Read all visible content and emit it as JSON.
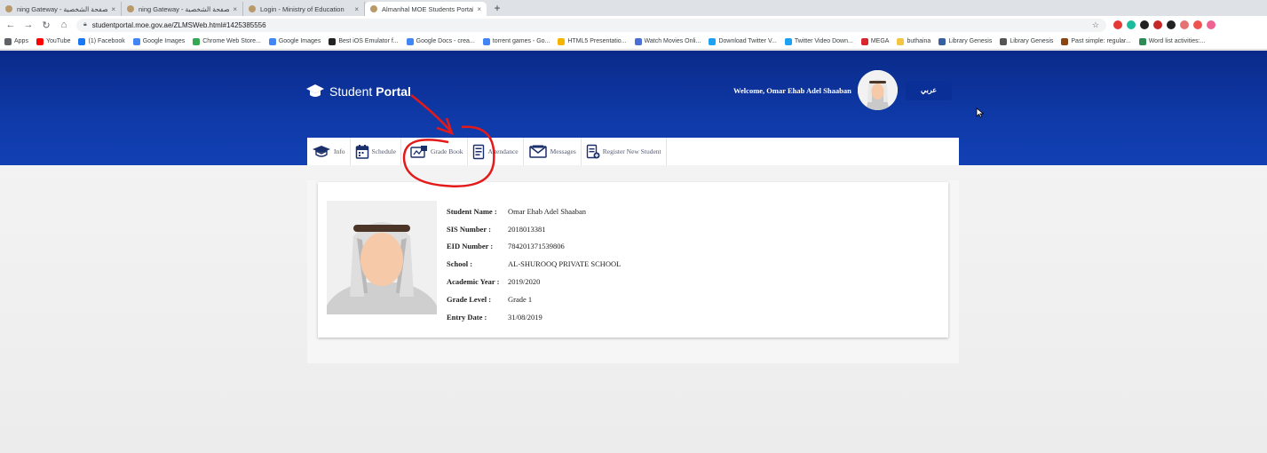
{
  "browser": {
    "tabs": [
      {
        "title": "ning Gateway - الصفحة الشخصية",
        "active": false
      },
      {
        "title": "ning Gateway - الصفحة الشخصية",
        "active": false
      },
      {
        "title": "Login - Ministry of Education",
        "active": false
      },
      {
        "title": "Almanhal MOE Students Portal",
        "active": true
      }
    ],
    "new_tab": "+",
    "close_glyph": "×",
    "url": "studentportal.moe.gov.ae/ZLMSWeb.html#1425385556",
    "bookmarks": [
      {
        "label": "Apps",
        "color": "#5f6368"
      },
      {
        "label": "YouTube",
        "color": "#ff0000"
      },
      {
        "label": "(1) Facebook",
        "color": "#1877f2"
      },
      {
        "label": "Google Images",
        "color": "#4285f4"
      },
      {
        "label": "Chrome Web Store...",
        "color": "#34a853"
      },
      {
        "label": "Google Images",
        "color": "#4285f4"
      },
      {
        "label": "Best iOS Emulator f...",
        "color": "#222222"
      },
      {
        "label": "Google Docs - crea...",
        "color": "#4285f4"
      },
      {
        "label": "torrent games - Go...",
        "color": "#4285f4"
      },
      {
        "label": "HTML5 Presentatio...",
        "color": "#f4b400"
      },
      {
        "label": "Watch Movies Onli...",
        "color": "#4a6fd6"
      },
      {
        "label": "Download Twitter V...",
        "color": "#1da1f2"
      },
      {
        "label": "Twitter Video Down...",
        "color": "#1da1f2"
      },
      {
        "label": "MEGA",
        "color": "#d9272e"
      },
      {
        "label": "buthaina",
        "color": "#f4c542"
      },
      {
        "label": "Library Genesis",
        "color": "#3a5fa0"
      },
      {
        "label": "Library Genesis",
        "color": "#555555"
      },
      {
        "label": "Past simple: regular...",
        "color": "#8b4513"
      },
      {
        "label": "Word list activities:...",
        "color": "#2e8b57"
      }
    ],
    "extension_colors": [
      "#e53935",
      "#1abc9c",
      "#222222",
      "#c62828",
      "#222222",
      "#e57373",
      "#ef5350",
      "#f06292"
    ]
  },
  "portal": {
    "logo_text": "Student",
    "logo_bold": "Portal",
    "welcome": "Welcome, Omar Ehab Adel Shaaban",
    "language_button": "عربي",
    "nav": [
      {
        "label": "Info",
        "icon": "graduation-cap-icon"
      },
      {
        "label": "Schedule",
        "icon": "calendar-icon"
      },
      {
        "label": "Grade Book",
        "icon": "grade-book-icon"
      },
      {
        "label": "Attendance",
        "icon": "attendance-icon"
      },
      {
        "label": "Messages",
        "icon": "envelope-icon"
      },
      {
        "label": "Register New Student",
        "icon": "register-icon"
      }
    ],
    "student": [
      {
        "label": "Student Name :",
        "value": "Omar Ehab Adel Shaaban"
      },
      {
        "label": "SIS Number :",
        "value": "2018013381"
      },
      {
        "label": "EID Number :",
        "value": "784201371539806"
      },
      {
        "label": "School :",
        "value": "AL-SHUROOQ PRIVATE SCHOOL"
      },
      {
        "label": "Academic Year :",
        "value": "2019/2020"
      },
      {
        "label": "Grade Level :",
        "value": "Grade 1"
      },
      {
        "label": "Entry Date :",
        "value": "31/08/2019"
      }
    ]
  },
  "colors": {
    "header_blue": "#0f3aa8",
    "annotation_red": "#e41a1a"
  }
}
